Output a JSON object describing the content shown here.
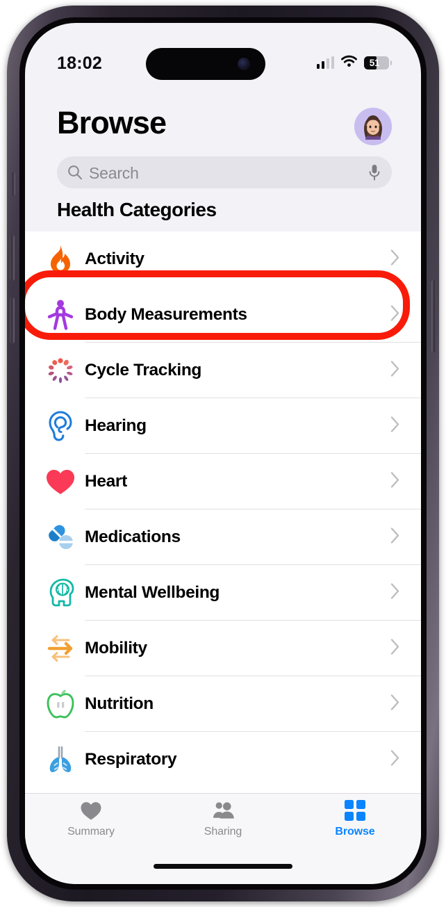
{
  "status_bar": {
    "time": "18:02",
    "signal_icon": "cellular-signal-icon",
    "signal_bars_active": 2,
    "wifi_icon": "wifi-icon",
    "battery_level": "51",
    "battery_percent": 51
  },
  "header": {
    "title": "Browse",
    "avatar_name": "profile-avatar",
    "avatar_bg": "#c9bdf0"
  },
  "search": {
    "placeholder": "Search",
    "value": "",
    "search_icon": "search-icon",
    "mic_icon": "microphone-icon"
  },
  "section": {
    "title": "Health Categories"
  },
  "categories": [
    {
      "label": "Activity",
      "icon": "flame-icon",
      "color": "#f56300",
      "highlighted": true
    },
    {
      "label": "Body Measurements",
      "icon": "body-figure-icon",
      "color": "#a33ae0",
      "highlighted": false
    },
    {
      "label": "Cycle Tracking",
      "icon": "cycle-burst-icon",
      "color": "#e8534a",
      "highlighted": false
    },
    {
      "label": "Hearing",
      "icon": "ear-icon",
      "color": "#1f7ddb",
      "highlighted": false
    },
    {
      "label": "Heart",
      "icon": "heart-icon",
      "color": "#fa3a56",
      "highlighted": false
    },
    {
      "label": "Medications",
      "icon": "pill-capsule-icon",
      "color": "#2e93df",
      "highlighted": false
    },
    {
      "label": "Mental Wellbeing",
      "icon": "head-brain-icon",
      "color": "#14b8a6",
      "highlighted": false
    },
    {
      "label": "Mobility",
      "icon": "arrows-exchange-icon",
      "color": "#f0a030",
      "highlighted": false
    },
    {
      "label": "Nutrition",
      "icon": "apple-icon",
      "color": "#3cc05a",
      "highlighted": false
    },
    {
      "label": "Respiratory",
      "icon": "lungs-icon",
      "color": "#3a9fe0",
      "highlighted": false
    }
  ],
  "tab_bar": {
    "items": [
      {
        "label": "Summary",
        "icon": "heart-icon",
        "active": false
      },
      {
        "label": "Sharing",
        "icon": "people-icon",
        "active": false
      },
      {
        "label": "Browse",
        "icon": "grid-icon",
        "active": true
      }
    ],
    "active_color": "#0a84ff",
    "inactive_color": "#8a8a8e"
  },
  "annotation": {
    "type": "highlight-rectangle",
    "target": "Activity",
    "color": "#f91b09"
  }
}
